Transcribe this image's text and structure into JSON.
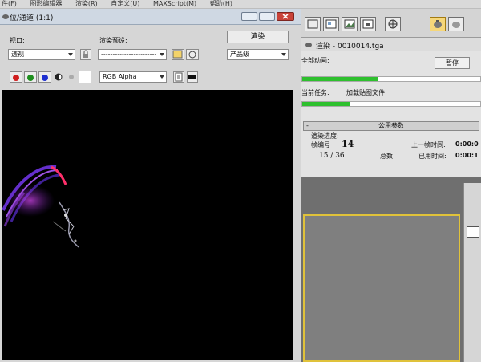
{
  "menubar": {
    "items": [
      "件(F)",
      "图形编辑器",
      "渲染(R)",
      "自定义(U)",
      "MAXScript(M)",
      "帮助(H)"
    ]
  },
  "frame_window": {
    "title": "位/通道 (1:1)",
    "viewport_label": "视口:",
    "viewport_value": "透视",
    "preset_label": "渲染预设:",
    "preset_value": "------------------------",
    "render_button": "渲染",
    "quality_value": "产品级",
    "channel_value": "RGB Alpha",
    "channel_colors": [
      "#d01f1f",
      "#1e8f1e",
      "#1e2fd0"
    ]
  },
  "progress_window": {
    "title": "渲染 - 0010014.tga",
    "total_label": "全部动画:",
    "pause_button": "暂停",
    "total_progress": 0.43,
    "current_task_label": "当前任务:",
    "current_task_value": "加载贴图文件",
    "task_progress": 0.27,
    "rollout_title": "公用参数",
    "group_title": "渲染进度:",
    "frame_label": "帧编号",
    "frame_value": "14",
    "frame_count": "15 / 36",
    "total_word": "总数",
    "last_frame_label": "上一帧时间:",
    "last_frame_value": "0:00:0",
    "elapsed_label": "已用时间:",
    "elapsed_value": "0:00:1"
  },
  "colors": {
    "progress_green": "#2ec02e",
    "viewport_border": "#e0c23a",
    "active_tool": "#f6d77a"
  }
}
